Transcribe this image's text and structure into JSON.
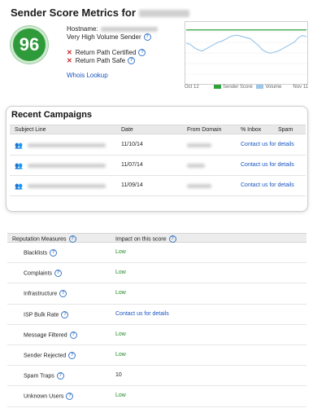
{
  "header": {
    "title": "Sender Score Metrics for",
    "score": "96",
    "hostname_label": "Hostname:",
    "volume_label": "Very High Volume Sender",
    "return_path_certified": "Return Path Certified",
    "return_path_safe": "Return Path Safe",
    "whois_link": "Whois Lookup"
  },
  "chart": {
    "start_label": "Oct 12",
    "end_label": "Nov 11",
    "legend": [
      "Sender Score",
      "Volume"
    ],
    "colors": {
      "sender_score": "#2fa33a",
      "volume": "#9cc7ea"
    }
  },
  "chart_data": {
    "type": "line",
    "x": [
      "Oct 12",
      "",
      "",
      "",
      "",
      "",
      "",
      "",
      "",
      "",
      "",
      "",
      "",
      "",
      "",
      "",
      "",
      "",
      "",
      "",
      "",
      "",
      "",
      "",
      "",
      "",
      "",
      "",
      "",
      "",
      "Nov 11"
    ],
    "series": [
      {
        "name": "Sender Score",
        "values": [
          96,
          96,
          96,
          96,
          96,
          96,
          96,
          96,
          96,
          96,
          96,
          96,
          96,
          96,
          96,
          96,
          96,
          96,
          96,
          96,
          96,
          96,
          96,
          96,
          96,
          96,
          96,
          96,
          96,
          96,
          96
        ]
      },
      {
        "name": "Volume",
        "values": [
          72,
          70,
          64,
          60,
          58,
          62,
          66,
          70,
          74,
          76,
          80,
          84,
          86,
          86,
          84,
          82,
          80,
          74,
          68,
          60,
          56,
          54,
          56,
          58,
          62,
          66,
          70,
          74,
          82,
          86,
          84
        ]
      }
    ],
    "ylim": [
      0,
      100
    ],
    "grid": true
  },
  "campaigns": {
    "heading": "Recent Campaigns",
    "columns": [
      "Subject Line",
      "Date",
      "From Domain",
      "% Inbox",
      "Spam"
    ],
    "rows": [
      {
        "date": "11/10/14",
        "link": "Contact us for details"
      },
      {
        "date": "11/07/14",
        "link": "Contact us for details"
      },
      {
        "date": "11/09/14",
        "link": "Contact us for details"
      }
    ]
  },
  "reputation": {
    "col_measure": "Reputation Measures",
    "col_impact": "Impact on this score",
    "rows": [
      {
        "name": "Blacklists",
        "help": true,
        "impact": "Low",
        "tone": "green"
      },
      {
        "name": "Complaints",
        "help": true,
        "impact": "Low",
        "tone": "green"
      },
      {
        "name": "Infrastructure",
        "help": true,
        "impact": "Low",
        "tone": "green"
      },
      {
        "name": "ISP Bulk Rate",
        "help": true,
        "impact": "Contact us for details",
        "tone": "blue"
      },
      {
        "name": "Message Filtered",
        "help": true,
        "impact": "Low",
        "tone": "green"
      },
      {
        "name": "Sender Rejected",
        "help": true,
        "impact": "Low",
        "tone": "green"
      },
      {
        "name": "Spam Traps",
        "help": true,
        "impact": "10",
        "tone": "plain"
      },
      {
        "name": "Unknown Users",
        "help": true,
        "impact": "Low",
        "tone": "green"
      }
    ]
  }
}
